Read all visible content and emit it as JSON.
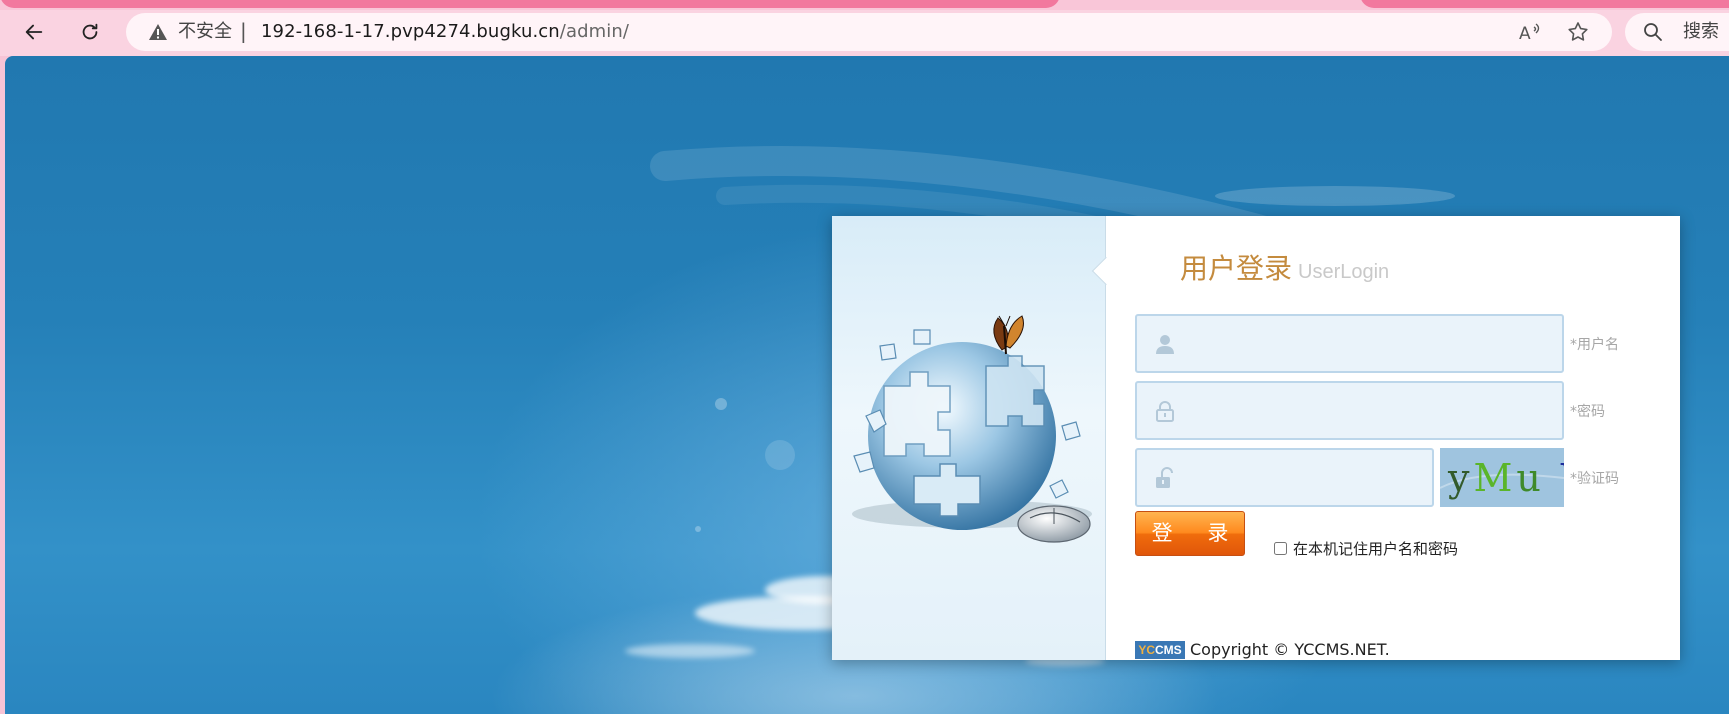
{
  "browser": {
    "back_label": "Back",
    "reload_label": "Reload",
    "security_label": "不安全",
    "separator": "|",
    "url_host": "192-168-1-17.pvp4274.bugku.cn",
    "url_path": "/admin/",
    "search_label": "搜索",
    "icons": [
      "back-arrow-icon",
      "reload-icon",
      "warning-icon",
      "read-aloud-icon",
      "star-icon",
      "search-icon"
    ]
  },
  "login": {
    "title_cn": "用户登录",
    "title_en": "UserLogin",
    "username": {
      "value": "",
      "hint": "*用户名"
    },
    "password": {
      "value": "",
      "hint": "*密码"
    },
    "captcha": {
      "value": "",
      "hint": "*验证码",
      "image_text": "yMu V"
    },
    "submit_label": "登 录",
    "remember_label": "在本机记住用户名和密码",
    "remember_checked": false
  },
  "footer": {
    "logo_text": "YCCMS",
    "copyright": "Copyright © YCCMS.NET."
  },
  "colors": {
    "title": "#c48b3e",
    "button": "#ff8a1e",
    "background": "#2178b0"
  }
}
